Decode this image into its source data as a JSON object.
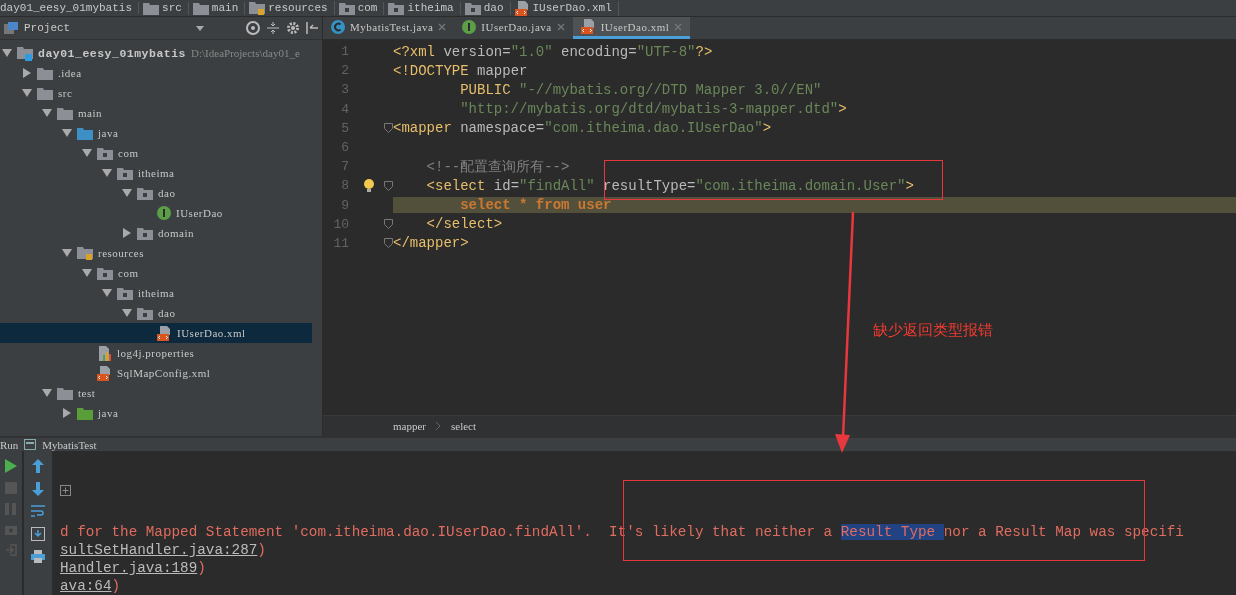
{
  "breadcrumbs": [
    {
      "label": "day01_eesy_01mybatis",
      "kind": "project"
    },
    {
      "label": "src",
      "kind": "folder"
    },
    {
      "label": "main",
      "kind": "folder"
    },
    {
      "label": "resources",
      "kind": "resources"
    },
    {
      "label": "com",
      "kind": "package"
    },
    {
      "label": "itheima",
      "kind": "package"
    },
    {
      "label": "dao",
      "kind": "package"
    },
    {
      "label": "IUserDao.xml",
      "kind": "xml"
    }
  ],
  "project_panel": {
    "title": "Project",
    "tree": [
      {
        "label": "day01_eesy_01mybatis",
        "path": "D:\\IdeaProjects\\day01_e",
        "kind": "module",
        "expanded": true,
        "selected": false,
        "children": [
          {
            "label": ".idea",
            "kind": "folder",
            "expanded": false,
            "selected": false
          },
          {
            "label": "src",
            "kind": "folder",
            "expanded": true,
            "selected": false,
            "children": [
              {
                "label": "main",
                "kind": "folder",
                "expanded": true,
                "selected": false,
                "children": [
                  {
                    "label": "java",
                    "kind": "source",
                    "expanded": true,
                    "selected": false,
                    "children": [
                      {
                        "label": "com",
                        "kind": "package",
                        "expanded": true,
                        "selected": false,
                        "children": [
                          {
                            "label": "itheima",
                            "kind": "package",
                            "expanded": true,
                            "selected": false,
                            "children": [
                              {
                                "label": "dao",
                                "kind": "package",
                                "expanded": true,
                                "selected": false,
                                "children": [
                                  {
                                    "label": "IUserDao",
                                    "kind": "interface",
                                    "selected": false
                                  }
                                ]
                              },
                              {
                                "label": "domain",
                                "kind": "package",
                                "expanded": false,
                                "selected": false
                              }
                            ]
                          }
                        ]
                      }
                    ]
                  },
                  {
                    "label": "resources",
                    "kind": "resources",
                    "expanded": true,
                    "selected": false,
                    "children": [
                      {
                        "label": "com",
                        "kind": "package",
                        "expanded": true,
                        "selected": false,
                        "children": [
                          {
                            "label": "itheima",
                            "kind": "package",
                            "expanded": true,
                            "selected": false,
                            "children": [
                              {
                                "label": "dao",
                                "kind": "package",
                                "expanded": true,
                                "selected": false,
                                "children": [
                                  {
                                    "label": "IUserDao.xml",
                                    "kind": "xml",
                                    "selected": true
                                  }
                                ]
                              }
                            ]
                          }
                        ]
                      },
                      {
                        "label": "log4j.properties",
                        "kind": "properties",
                        "selected": false
                      },
                      {
                        "label": "SqlMapConfig.xml",
                        "kind": "xml",
                        "selected": false
                      }
                    ]
                  }
                ]
              },
              {
                "label": "test",
                "kind": "folder",
                "expanded": true,
                "selected": false,
                "children": [
                  {
                    "label": "java",
                    "kind": "test",
                    "expanded": false,
                    "selected": false
                  }
                ]
              }
            ]
          }
        ]
      }
    ]
  },
  "editor": {
    "tabs": [
      {
        "label": "MybatisTest.java",
        "kind": "class",
        "selected": false
      },
      {
        "label": "IUserDao.java",
        "kind": "interface",
        "selected": false
      },
      {
        "label": "IUserDao.xml",
        "kind": "xml",
        "selected": true
      }
    ],
    "lines": [
      {
        "number": "1",
        "fold": false,
        "bulb": false,
        "highlighted": false,
        "tokens": [
          {
            "kind": "tag",
            "text": "<?xml"
          },
          {
            "kind": "attr",
            "text": " version="
          },
          {
            "kind": "str",
            "text": "\"1.0\""
          },
          {
            "kind": "attr",
            "text": " encoding="
          },
          {
            "kind": "str",
            "text": "\"UTF-8\""
          },
          {
            "kind": "tag",
            "text": "?>"
          }
        ]
      },
      {
        "number": "2",
        "fold": false,
        "bulb": false,
        "highlighted": false,
        "tokens": [
          {
            "kind": "tag",
            "text": "<!DOCTYPE"
          },
          {
            "kind": "attr",
            "text": " mapper"
          }
        ]
      },
      {
        "number": "3",
        "fold": false,
        "bulb": false,
        "highlighted": false,
        "tokens": [
          {
            "kind": "tag",
            "text": "        PUBLIC "
          },
          {
            "kind": "str",
            "text": "\"-//mybatis.org//DTD Mapper 3.0//EN\""
          }
        ]
      },
      {
        "number": "4",
        "fold": false,
        "bulb": false,
        "highlighted": false,
        "tokens": [
          {
            "kind": "str",
            "text": "        \"http://mybatis.org/dtd/mybatis-3-mapper.dtd\""
          },
          {
            "kind": "tag",
            "text": ">"
          }
        ]
      },
      {
        "number": "5",
        "fold": true,
        "bulb": false,
        "highlighted": false,
        "tokens": [
          {
            "kind": "tag",
            "text": "<mapper"
          },
          {
            "kind": "attr",
            "text": " namespace="
          },
          {
            "kind": "str",
            "text": "\"com.itheima.dao.IUserDao\""
          },
          {
            "kind": "tag",
            "text": ">"
          }
        ]
      },
      {
        "number": "6",
        "fold": false,
        "bulb": false,
        "highlighted": false
      },
      {
        "number": "7",
        "fold": false,
        "bulb": false,
        "highlighted": false,
        "tokens": [
          {
            "kind": "comment",
            "text": "    <!--配置查询所有-->"
          }
        ]
      },
      {
        "number": "8",
        "fold": true,
        "bulb": true,
        "highlighted": false,
        "tokens": [
          {
            "kind": "tag",
            "text": "    <select"
          },
          {
            "kind": "attr",
            "text": " id="
          },
          {
            "kind": "str",
            "text": "\"findAll\""
          },
          {
            "kind": "attr",
            "text": " resultType="
          },
          {
            "kind": "str",
            "text": "\"com.itheima.domain.User\""
          },
          {
            "kind": "tag",
            "text": ">"
          }
        ]
      },
      {
        "number": "9",
        "fold": false,
        "bulb": false,
        "highlighted": true,
        "tokens": [
          {
            "kind": "sql",
            "text": "        select * from user"
          }
        ]
      },
      {
        "number": "10",
        "fold": true,
        "bulb": false,
        "highlighted": false,
        "tokens": [
          {
            "kind": "tag",
            "text": "    </select>"
          }
        ]
      },
      {
        "number": "11",
        "fold": true,
        "bulb": false,
        "highlighted": false,
        "tokens": [
          {
            "kind": "tag",
            "text": "</mapper>"
          }
        ]
      }
    ],
    "breadcrumbs": [
      "mapper",
      "select"
    ]
  },
  "annotation": {
    "text": "缺少返回类型报错"
  },
  "run_panel": {
    "label": "Run",
    "tab": "MybatisTest",
    "console": [
      {
        "kind": "error",
        "parts": [
          {
            "text": "d for the Mapped Statement 'com.itheima.dao.IUserDao.findAll'.  It's likely that neither a ",
            "selected": false
          },
          {
            "text": "Result Type ",
            "selected": true
          },
          {
            "text": "nor a Result Map was specifi",
            "selected": false
          }
        ]
      },
      {
        "kind": "trace",
        "link": "sultSetHandler.java:287",
        "tail": ")"
      },
      {
        "kind": "trace",
        "link": "Handler.java:189",
        "tail": ")"
      },
      {
        "kind": "trace",
        "link": "ava:64",
        "tail": ")"
      }
    ]
  }
}
